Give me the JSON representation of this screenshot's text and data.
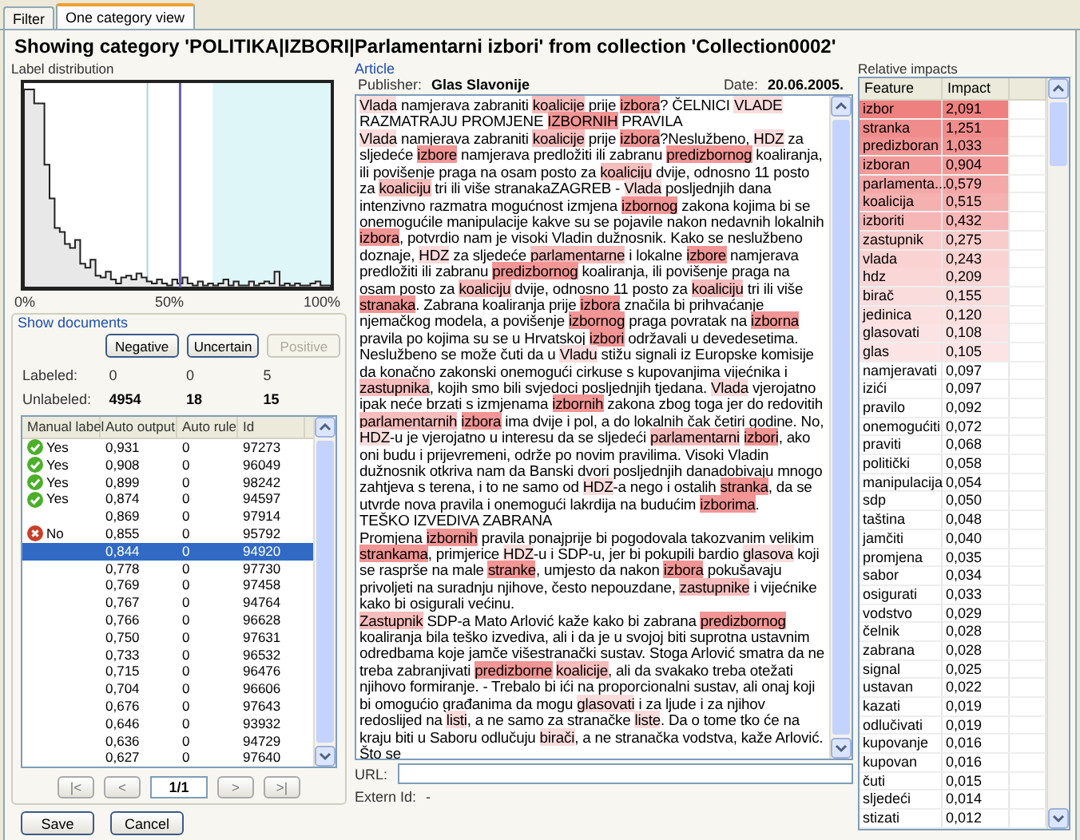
{
  "tabs": [
    {
      "label": "Filter",
      "selected": false
    },
    {
      "label": "One category view",
      "selected": true
    }
  ],
  "heading": "Showing category 'POLITIKA|IZBORI|Parlamentarni izbori' from collection 'Collection0002'",
  "label_distribution": {
    "title": "Label distribution",
    "axis_labels": [
      "0%",
      "50%",
      "100%"
    ]
  },
  "show_documents": {
    "title": "Show documents",
    "buttons": [
      {
        "label": "Negative",
        "disabled": false
      },
      {
        "label": "Uncertain",
        "disabled": false
      },
      {
        "label": "Positive",
        "disabled": true
      }
    ],
    "counts": [
      {
        "kind": "labeled",
        "label": "Labeled:",
        "values": [
          "0",
          "0",
          "5"
        ]
      },
      {
        "kind": "unlabeled",
        "label": "Unlabeled:",
        "values": [
          "4954",
          "18",
          "15"
        ]
      }
    ]
  },
  "documents": {
    "columns": [
      "Manual label",
      "Auto output",
      "Auto rule",
      "Id"
    ],
    "rows": [
      {
        "manual_label": {
          "kind": "yes",
          "text": "Yes"
        },
        "auto_output": "0,931",
        "auto_rule": "0",
        "id": "97273",
        "selected": false
      },
      {
        "manual_label": {
          "kind": "yes",
          "text": "Yes"
        },
        "auto_output": "0,908",
        "auto_rule": "0",
        "id": "96049",
        "selected": false
      },
      {
        "manual_label": {
          "kind": "yes",
          "text": "Yes"
        },
        "auto_output": "0,899",
        "auto_rule": "0",
        "id": "98242",
        "selected": false
      },
      {
        "manual_label": {
          "kind": "yes",
          "text": "Yes"
        },
        "auto_output": "0,874",
        "auto_rule": "0",
        "id": "94597",
        "selected": false
      },
      {
        "auto_output": "0,869",
        "auto_rule": "0",
        "id": "97914",
        "selected": false
      },
      {
        "manual_label": {
          "kind": "no",
          "text": "No"
        },
        "auto_output": "0,855",
        "auto_rule": "0",
        "id": "95792",
        "selected": false
      },
      {
        "auto_output": "0,844",
        "auto_rule": "0",
        "id": "94920",
        "selected": true
      },
      {
        "auto_output": "0,778",
        "auto_rule": "0",
        "id": "97730",
        "selected": false
      },
      {
        "auto_output": "0,769",
        "auto_rule": "0",
        "id": "97458",
        "selected": false
      },
      {
        "auto_output": "0,767",
        "auto_rule": "0",
        "id": "94764",
        "selected": false
      },
      {
        "auto_output": "0,766",
        "auto_rule": "0",
        "id": "96628",
        "selected": false
      },
      {
        "auto_output": "0,750",
        "auto_rule": "0",
        "id": "97631",
        "selected": false
      },
      {
        "auto_output": "0,733",
        "auto_rule": "0",
        "id": "96532",
        "selected": false
      },
      {
        "auto_output": "0,715",
        "auto_rule": "0",
        "id": "96476",
        "selected": false
      },
      {
        "auto_output": "0,704",
        "auto_rule": "0",
        "id": "96606",
        "selected": false
      },
      {
        "auto_output": "0,676",
        "auto_rule": "0",
        "id": "97643",
        "selected": false
      },
      {
        "auto_output": "0,646",
        "auto_rule": "0",
        "id": "93932",
        "selected": false
      },
      {
        "auto_output": "0,636",
        "auto_rule": "0",
        "id": "94729",
        "selected": false
      },
      {
        "auto_output": "0,627",
        "auto_rule": "0",
        "id": "97640",
        "selected": false
      }
    ]
  },
  "pager": {
    "first": "|<",
    "prev": "<",
    "page": "1/1",
    "next": ">",
    "last": ">|"
  },
  "article": {
    "title": "Article",
    "publisher_label": "Publisher:",
    "publisher": "Glas Slavonije",
    "date_label": "Date:",
    "date": "20.06.2005.",
    "paragraphs": [
      [
        {
          "text": "Vlada",
          "color": "#fbdcdc"
        },
        {
          "text": " namjerava zabraniti "
        },
        {
          "text": "koalicije",
          "color": "#f7bcbc"
        },
        {
          "text": " prije "
        },
        {
          "text": "izbora",
          "color": "#f29595"
        },
        {
          "text": "? ČELNICI "
        },
        {
          "text": "VLADE",
          "color": "#fbdcdc"
        },
        {
          "text": " RAZMATRAJU PROMJENE "
        },
        {
          "text": "IZBORNIH",
          "color": "#f29595"
        },
        {
          "text": " PRAVILA"
        }
      ],
      [
        {
          "text": "Vlada",
          "color": "#fbdcdc"
        },
        {
          "text": " namjerava zabraniti "
        },
        {
          "text": "koalicije",
          "color": "#f7bcbc"
        },
        {
          "text": " prije "
        },
        {
          "text": "izbora",
          "color": "#f29595"
        },
        {
          "text": "?Neslužbeno, "
        },
        {
          "text": "HDZ",
          "color": "#fbdcdc"
        },
        {
          "text": " za sljedeće "
        },
        {
          "text": "izbore",
          "color": "#f29595"
        },
        {
          "text": " namjerava predložiti ili zabranu "
        },
        {
          "text": "predizbornog",
          "color": "#f29595"
        },
        {
          "text": " koaliranja, ili povišenje praga na osam posto za "
        },
        {
          "text": "koaliciju",
          "color": "#f7bcbc"
        },
        {
          "text": " dvije, odnosno 11 posto za "
        },
        {
          "text": "koaliciju",
          "color": "#f7bcbc"
        },
        {
          "text": " tri ili više stranakaZAGREB - "
        },
        {
          "text": "Vlada",
          "color": "#fbdcdc"
        },
        {
          "text": " posljednjih dana intenzivno razmatra mogućnost izmjena "
        },
        {
          "text": "izbornog",
          "color": "#f29595"
        },
        {
          "text": " zakona kojima bi se onemogućile manipulacije kakve su se pojavile nakon nedavnih lokalnih "
        },
        {
          "text": "izbora",
          "color": "#f29595"
        },
        {
          "text": ", potvrdio nam je visoki Vladin dužnosnik. Kako se neslužbeno doznaje, "
        },
        {
          "text": "HDZ",
          "color": "#fbdcdc"
        },
        {
          "text": " za sljedeće "
        },
        {
          "text": "parlamentarne",
          "color": "#f7bcbc"
        },
        {
          "text": " i lokalne "
        },
        {
          "text": "izbore",
          "color": "#f29595"
        },
        {
          "text": " namjerava predložiti ili zabranu "
        },
        {
          "text": "predizbornog",
          "color": "#f29595"
        },
        {
          "text": " koaliranja, ili povišenje praga na osam posto za "
        },
        {
          "text": "koaliciju",
          "color": "#f7bcbc"
        },
        {
          "text": " dvije, odnosno 11 posto za "
        },
        {
          "text": "koaliciju",
          "color": "#f7bcbc"
        },
        {
          "text": " tri ili više "
        },
        {
          "text": "stranaka",
          "color": "#f29595"
        },
        {
          "text": ". Zabrana koaliranja prije "
        },
        {
          "text": "izbora",
          "color": "#f29595"
        },
        {
          "text": " značila bi prihvaćanje njemačkog modela, a povišenje "
        },
        {
          "text": "izbornog",
          "color": "#f29595"
        },
        {
          "text": " praga povratak na "
        },
        {
          "text": "izborna",
          "color": "#f29595"
        },
        {
          "text": " pravila po kojima su se u Hrvatskoj "
        },
        {
          "text": "izbori",
          "color": "#f29595"
        },
        {
          "text": " održavali u devedesetima. Neslužbeno se može čuti da u "
        },
        {
          "text": "Vladu",
          "color": "#fbdcdc"
        },
        {
          "text": " stižu signali iz Europske komisije da konačno zakonski onemogući cirkuse s kupovanjima vijećnika i "
        },
        {
          "text": "zastupnika",
          "color": "#f7bcbc"
        },
        {
          "text": ", kojih smo bili svjedoci posljednjih tjedana. "
        },
        {
          "text": "Vlada",
          "color": "#fbdcdc"
        },
        {
          "text": " vjerojatno ipak neće brzati s izmjenama "
        },
        {
          "text": "izbornih",
          "color": "#f29595"
        },
        {
          "text": " zakona zbog toga jer do redovitih "
        },
        {
          "text": "parlamentarnih",
          "color": "#f7bcbc"
        },
        {
          "text": "izbora",
          "color": "#f29595"
        },
        {
          "text": " ima dvije i pol, a do lokalnih čak četiri godine. No, "
        },
        {
          "text": "HDZ",
          "color": "#fbdcdc"
        },
        {
          "text": "-u je vjerojatno u interesu da se sljedeći "
        },
        {
          "text": "parlamentarni",
          "color": "#f7bcbc"
        },
        {
          "text": "izbori",
          "color": "#f29595"
        },
        {
          "text": ", ako oni budu i prijevremeni, održe po novim pravilima. Visoki Vladin dužnosnik otkriva nam da Banski dvori posljednjih danadobivaju mnogo zahtjeva s terena, i to ne samo od "
        },
        {
          "text": "HDZ",
          "color": "#fbdcdc"
        },
        {
          "text": "-a nego i ostalih "
        },
        {
          "text": "stranka",
          "color": "#f29595"
        },
        {
          "text": ", da se utvrde nova pravila i onemogući lakrdija na budućim "
        },
        {
          "text": "izborima",
          "color": "#f29595"
        },
        {
          "text": "."
        }
      ],
      [
        {
          "text": "TEŠKO IZVEDIVA ZABRANA"
        }
      ],
      [
        {
          "text": "Promjena "
        },
        {
          "text": "izbornih",
          "color": "#f29595"
        },
        {
          "text": " pravila ponajprije bi pogodovala takozvanim velikim "
        },
        {
          "text": "strankama",
          "color": "#f29595"
        },
        {
          "text": ", primjerice "
        },
        {
          "text": "HDZ",
          "color": "#fbdcdc"
        },
        {
          "text": "-u i SDP-u, jer bi pokupili bardio "
        },
        {
          "text": "glasova",
          "color": "#fbdcdc"
        },
        {
          "text": " koji se rasprše na male "
        },
        {
          "text": "stranke",
          "color": "#f29595"
        },
        {
          "text": ", umjesto da nakon "
        },
        {
          "text": "izbora",
          "color": "#f29595"
        },
        {
          "text": " pokušavaju privoljeti na suradnju njihove, često nepouzdane, "
        },
        {
          "text": "zastupnike",
          "color": "#f7bcbc"
        },
        {
          "text": " i vijećnike kako bi osigurali većinu."
        }
      ],
      [
        {
          "text": "Zastupnik",
          "color": "#f7bcbc"
        },
        {
          "text": " SDP-a Mato Arlović kaže kako bi zabrana "
        },
        {
          "text": "predizbornog",
          "color": "#f29595"
        },
        {
          "text": " koaliranja bila teško izvediva, ali i da je u svojoj biti suprotna ustavnim odredbama koje jamče višestranački sustav. Stoga Arlović smatra da ne treba zabranjivati "
        },
        {
          "text": "predizborne",
          "color": "#f29595"
        },
        {
          "text": "koalicije",
          "color": "#f7bcbc"
        },
        {
          "text": ", ali da svakako treba otežati njihovo formiranje. - Trebalo bi ići na proporcionalni sustav, ali onaj koji bi omogućio građanima da mogu "
        },
        {
          "text": "glasovati",
          "color": "#fbdcdc"
        },
        {
          "text": " i za ljude i za njihov redoslijed na "
        },
        {
          "text": "listi",
          "color": "#fbdcdc"
        },
        {
          "text": ", a ne samo za stranačke "
        },
        {
          "text": "liste",
          "color": "#fbdcdc"
        },
        {
          "text": ". Da o tome tko će na kraju biti u Saboru odlučuju "
        },
        {
          "text": "birači",
          "color": "#fbdcdc"
        },
        {
          "text": ", a ne stranačka vodstva, kaže Arlović. Što se"
        }
      ]
    ],
    "url_label": "URL:",
    "extern_label": "Extern Id:",
    "extern_id": "-"
  },
  "impacts": {
    "title": "Relative impacts",
    "columns": [
      "Feature",
      "Impact"
    ],
    "rows": [
      {
        "feature": "izbor",
        "impact": "2,091",
        "color": "#ee8080"
      },
      {
        "feature": "stranka",
        "impact": "1,251",
        "color": "#f08c8c"
      },
      {
        "feature": "predizboran",
        "impact": "1,033",
        "color": "#f19494"
      },
      {
        "feature": "izboran",
        "impact": "0,904",
        "color": "#f29a9a"
      },
      {
        "feature": "parlamenta...",
        "impact": "0,579",
        "color": "#f4a8a8"
      },
      {
        "feature": "koalicija",
        "impact": "0,515",
        "color": "#f5b0b0"
      },
      {
        "feature": "izboriti",
        "impact": "0,432",
        "color": "#f6b6b6"
      },
      {
        "feature": "zastupnik",
        "impact": "0,275",
        "color": "#f9cccc"
      },
      {
        "feature": "vlada",
        "impact": "0,243",
        "color": "#fad2d2"
      },
      {
        "feature": "hdz",
        "impact": "0,209",
        "color": "#fad6d6"
      },
      {
        "feature": "birač",
        "impact": "0,155",
        "color": "#fbdcdc"
      },
      {
        "feature": "jedinica",
        "impact": "0,120",
        "color": "#fce0e0"
      },
      {
        "feature": "glasovati",
        "impact": "0,108",
        "color": "#fce3e3"
      },
      {
        "feature": "glas",
        "impact": "0,105",
        "color": "#fce4e4"
      },
      {
        "feature": "namjeravati",
        "impact": "0,097"
      },
      {
        "feature": "izići",
        "impact": "0,097"
      },
      {
        "feature": "pravilo",
        "impact": "0,092"
      },
      {
        "feature": "onemogućiti",
        "impact": "0,072"
      },
      {
        "feature": "praviti",
        "impact": "0,068"
      },
      {
        "feature": "politički",
        "impact": "0,058"
      },
      {
        "feature": "manipulacija",
        "impact": "0,054"
      },
      {
        "feature": "sdp",
        "impact": "0,050"
      },
      {
        "feature": "taština",
        "impact": "0,048"
      },
      {
        "feature": "jamčiti",
        "impact": "0,040"
      },
      {
        "feature": "promjena",
        "impact": "0,035"
      },
      {
        "feature": "sabor",
        "impact": "0,034"
      },
      {
        "feature": "osigurati",
        "impact": "0,033"
      },
      {
        "feature": "vodstvo",
        "impact": "0,029"
      },
      {
        "feature": "čelnik",
        "impact": "0,028"
      },
      {
        "feature": "zabrana",
        "impact": "0,028"
      },
      {
        "feature": "signal",
        "impact": "0,025"
      },
      {
        "feature": "ustavan",
        "impact": "0,022"
      },
      {
        "feature": "kazati",
        "impact": "0,019"
      },
      {
        "feature": "odlučivati",
        "impact": "0,019"
      },
      {
        "feature": "kupovanje",
        "impact": "0,016"
      },
      {
        "feature": "kupovan",
        "impact": "0,016"
      },
      {
        "feature": "čuti",
        "impact": "0,015"
      },
      {
        "feature": "sljedeći",
        "impact": "0,014"
      },
      {
        "feature": "stizati",
        "impact": "0,012"
      }
    ]
  },
  "buttons": [
    "Save",
    "Cancel"
  ]
}
